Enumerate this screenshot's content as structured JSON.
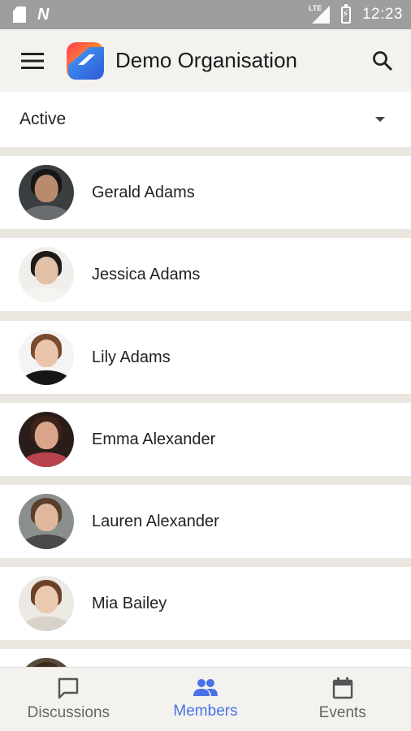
{
  "status_bar": {
    "time": "12:23",
    "network": "LTE"
  },
  "app_bar": {
    "title": "Demo Organisation"
  },
  "filter": {
    "selected": "Active"
  },
  "members": [
    {
      "name": "Gerald Adams"
    },
    {
      "name": "Jessica Adams"
    },
    {
      "name": "Lily Adams"
    },
    {
      "name": "Emma Alexander"
    },
    {
      "name": "Lauren Alexander"
    },
    {
      "name": "Mia Bailey"
    }
  ],
  "bottom_nav": {
    "items": [
      {
        "label": "Discussions",
        "icon": "chat-bubble-icon",
        "active": false
      },
      {
        "label": "Members",
        "icon": "people-icon",
        "active": true
      },
      {
        "label": "Events",
        "icon": "calendar-icon",
        "active": false
      }
    ]
  },
  "colors": {
    "accent": "#4a72e8",
    "background": "#e9e7df",
    "status_bar": "#9e9e9e"
  }
}
